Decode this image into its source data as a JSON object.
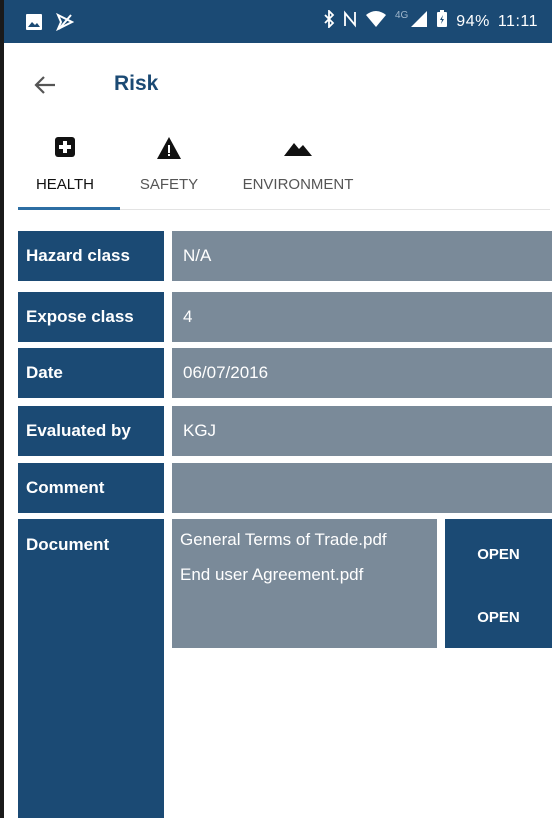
{
  "colors": {
    "primary": "#1b4a74",
    "cell_bg": "#7a8a99",
    "tab_indicator": "#2d6ea3"
  },
  "statusbar": {
    "left_icons": [
      "image-icon",
      "notification-slash-icon"
    ],
    "right_icons": [
      "bluetooth-icon",
      "nfc-icon",
      "wifi-icon",
      "signal-icon",
      "battery-icon"
    ],
    "network_label": "4G",
    "battery": "94%",
    "time": "11:11"
  },
  "appbar": {
    "back_icon": "arrow-left-icon",
    "title": "Risk"
  },
  "tabs": [
    {
      "label": "HEALTH",
      "icon": "medical-cross-icon",
      "active": true
    },
    {
      "label": "SAFETY",
      "icon": "warning-triangle-icon",
      "active": false
    },
    {
      "label": "ENVIRONMENT",
      "icon": "mountain-icon",
      "active": false
    }
  ],
  "fields": [
    {
      "label": "Hazard class",
      "value": "N/A"
    },
    {
      "label": "Expose class",
      "value": "4"
    },
    {
      "label": "Date",
      "value": "06/07/2016"
    },
    {
      "label": "Evaluated by",
      "value": "KGJ"
    },
    {
      "label": "Comment",
      "value": ""
    }
  ],
  "document": {
    "label": "Document",
    "files": [
      {
        "name": "General Terms of Trade.pdf",
        "action": "OPEN"
      },
      {
        "name": "End user Agreement.pdf",
        "action": "OPEN"
      }
    ]
  }
}
